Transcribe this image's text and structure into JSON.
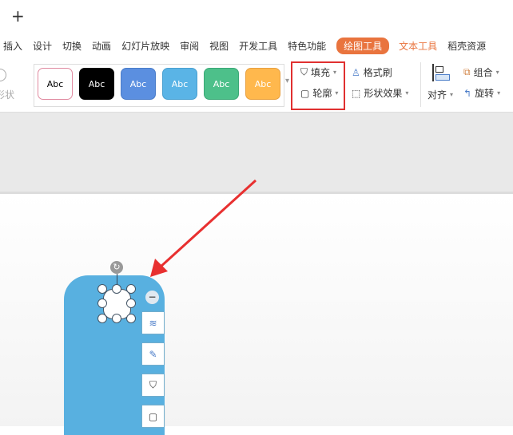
{
  "topbar": {
    "new_tab": "+"
  },
  "menu": [
    "插入",
    "设计",
    "切换",
    "动画",
    "幻灯片放映",
    "审阅",
    "视图",
    "开发工具",
    "特色功能",
    "绘图工具",
    "文本工具",
    "稻壳资源"
  ],
  "ribbon": {
    "shape_label": "形状",
    "styles": [
      {
        "text": "Abc",
        "bg": "#ffffff",
        "fg": "#000",
        "border": "#e08aa0"
      },
      {
        "text": "Abc",
        "bg": "#000000",
        "fg": "#fff",
        "border": "#000"
      },
      {
        "text": "Abc",
        "bg": "#5b8fe0",
        "fg": "#fff",
        "border": "#4a7cc8"
      },
      {
        "text": "Abc",
        "bg": "#5ab4e6",
        "fg": "#fff",
        "border": "#4aa0d0"
      },
      {
        "text": "Abc",
        "bg": "#4dc08a",
        "fg": "#fff",
        "border": "#3aa876"
      },
      {
        "text": "Abc",
        "bg": "#ffb84d",
        "fg": "#fff",
        "border": "#e8a040"
      }
    ],
    "fill": "填充",
    "outline": "轮廓",
    "format_painter": "格式刷",
    "shape_effects": "形状效果",
    "align": "对齐",
    "group": "组合",
    "rotate": "旋转"
  },
  "colors": {
    "accent": "#e9743e",
    "highlight": "#e03030",
    "shape": "#58b0e0"
  }
}
